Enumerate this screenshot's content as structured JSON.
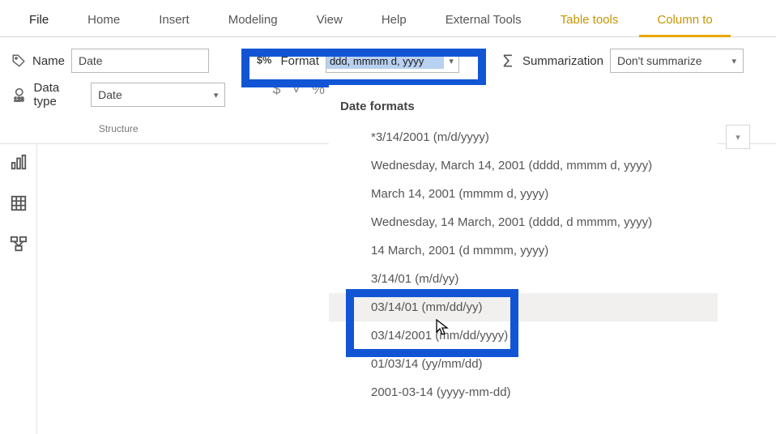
{
  "tabs": {
    "file": "File",
    "home": "Home",
    "insert": "Insert",
    "modeling": "Modeling",
    "view": "View",
    "help": "Help",
    "external_tools": "External Tools",
    "table_tools": "Table tools",
    "column_tools": "Column to"
  },
  "ribbon": {
    "name_label": "Name",
    "name_value": "Date",
    "datatype_label": "Data type",
    "datatype_value": "Date",
    "structure_caption": "Structure",
    "format_label": "Format",
    "format_value": "ddd, mmmm d, yyyy",
    "fmt_icons": {
      "currency": "$",
      "caret": "˅",
      "percent": "%"
    },
    "summ_label": "Summarization",
    "summ_value": "Don't summarize"
  },
  "dropdown": {
    "header": "Date formats",
    "items": [
      "*3/14/2001 (m/d/yyyy)",
      "Wednesday, March 14, 2001 (dddd, mmmm d, yyyy)",
      "March 14, 2001 (mmmm d, yyyy)",
      "Wednesday, 14 March, 2001 (dddd, d mmmm, yyyy)",
      "14 March, 2001 (d mmmm, yyyy)",
      "3/14/01 (m/d/yy)",
      "03/14/01 (mm/dd/yy)",
      "03/14/2001 (mm/dd/yyyy)",
      "01/03/14 (yy/mm/dd)",
      "2001-03-14 (yyyy-mm-dd)"
    ]
  }
}
